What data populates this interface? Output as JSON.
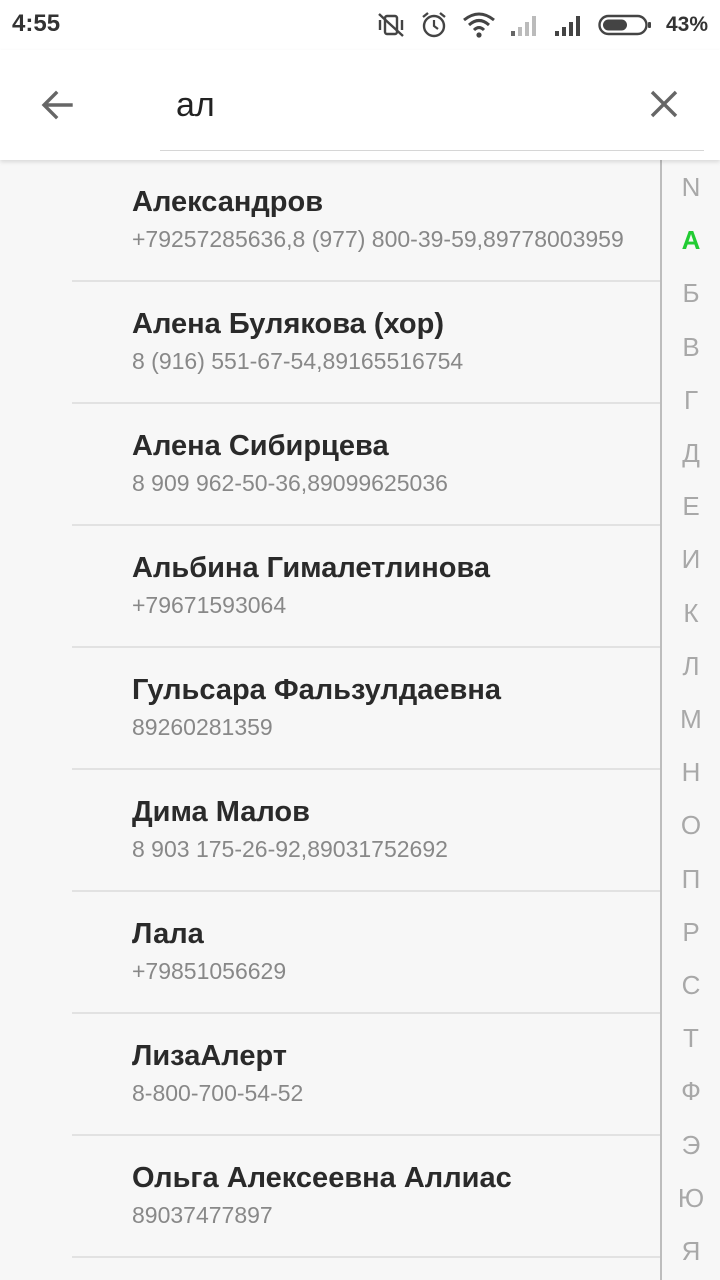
{
  "status_bar": {
    "time": "4:55",
    "battery_percent": "43%",
    "icons": [
      "vibrate-off-icon",
      "alarm-icon",
      "wifi-icon",
      "signal-icon",
      "signal-icon",
      "battery-icon"
    ]
  },
  "search": {
    "query": "ал",
    "back_icon": "arrow-left-icon",
    "clear_icon": "close-icon"
  },
  "contacts": [
    {
      "name": "Александров",
      "phone": "+79257285636,8 (977) 800-39-59,89778003959"
    },
    {
      "name": "Алена Булякова (хор)",
      "phone": "8 (916) 551-67-54,89165516754"
    },
    {
      "name": "Алена Сибирцева",
      "phone": "8 909 962-50-36,89099625036"
    },
    {
      "name": "Альбина Гималетлинова",
      "phone": "+79671593064"
    },
    {
      "name": "Гульсара Фальзулдаевна",
      "phone": "89260281359"
    },
    {
      "name": "Дима Малов",
      "phone": "8 903 175-26-92,89031752692"
    },
    {
      "name": "Лала",
      "phone": "+79851056629"
    },
    {
      "name": "ЛизаАлерт",
      "phone": "8-800-700-54-52"
    },
    {
      "name": "Ольга Алексеевна Аллиас",
      "phone": "89037477897"
    }
  ],
  "alphabet_index": {
    "letters": [
      "N",
      "А",
      "Б",
      "В",
      "Г",
      "Д",
      "Е",
      "И",
      "К",
      "Л",
      "М",
      "Н",
      "О",
      "П",
      "Р",
      "С",
      "Т",
      "Ф",
      "Э",
      "Ю",
      "Я"
    ],
    "active": "А",
    "active_color": "#22cc33"
  }
}
